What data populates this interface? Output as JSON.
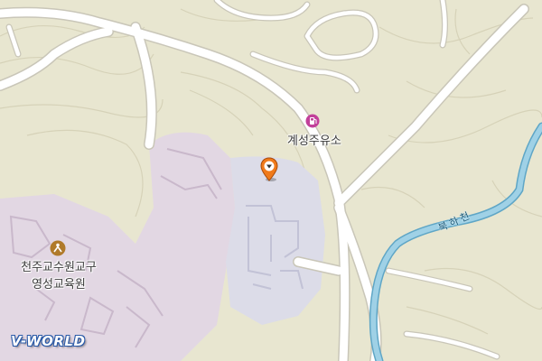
{
  "map": {
    "colors": {
      "land": "#e8e6d0",
      "campus": "#e2d7e3",
      "facility": "#dcdce8",
      "road": "#ffffff",
      "road_edge": "#c9c6b8",
      "contour": "#d6d2b8",
      "river": "#9fd1e6",
      "river_edge": "#5fa6c6",
      "marker": "#f07a1a",
      "gas_icon": "#c2409a"
    },
    "labels": {
      "gas_station": "계성주유소",
      "institute_line1": "천주교수원교구",
      "institute_line2": "영성교육원",
      "river": "북하천"
    },
    "icons": {
      "gas_station": "gas-station-icon",
      "institute": "religious-facility-icon",
      "location": "location-pin-icon"
    },
    "logo": "V-WORLD"
  }
}
